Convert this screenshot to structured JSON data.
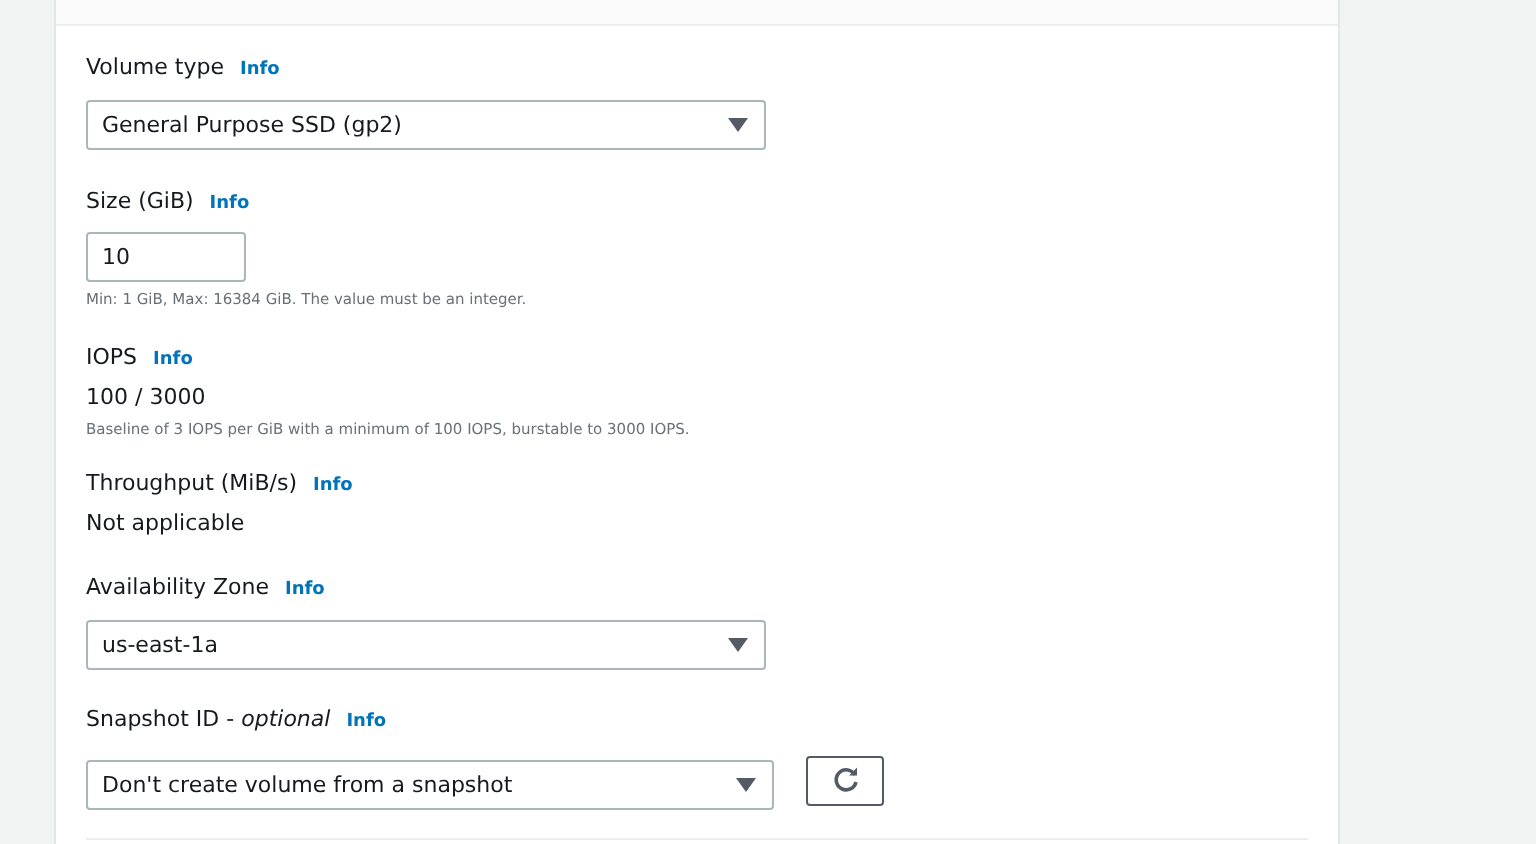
{
  "fields": [
    {
      "kind": "select",
      "label": "Volume type",
      "info": "Info",
      "value": "General Purpose SSD (gp2)"
    },
    {
      "kind": "input",
      "label": "Size (GiB)",
      "info": "Info",
      "value": "10",
      "hint": "Min: 1 GiB, Max: 16384 GiB. The value must be an integer."
    },
    {
      "kind": "static",
      "label": "IOPS",
      "info": "Info",
      "value": "100 / 3000",
      "hint": "Baseline of 3 IOPS per GiB with a minimum of 100 IOPS, burstable to 3000 IOPS."
    },
    {
      "kind": "static",
      "label": "Throughput (MiB/s)",
      "info": "Info",
      "value": "Not applicable"
    },
    {
      "kind": "select",
      "label": "Availability Zone",
      "info": "Info",
      "value": "us-east-1a"
    },
    {
      "kind": "select-refresh",
      "label": "Snapshot ID - *optional*",
      "info": "Info",
      "value": "Don't create volume from a snapshot"
    }
  ]
}
